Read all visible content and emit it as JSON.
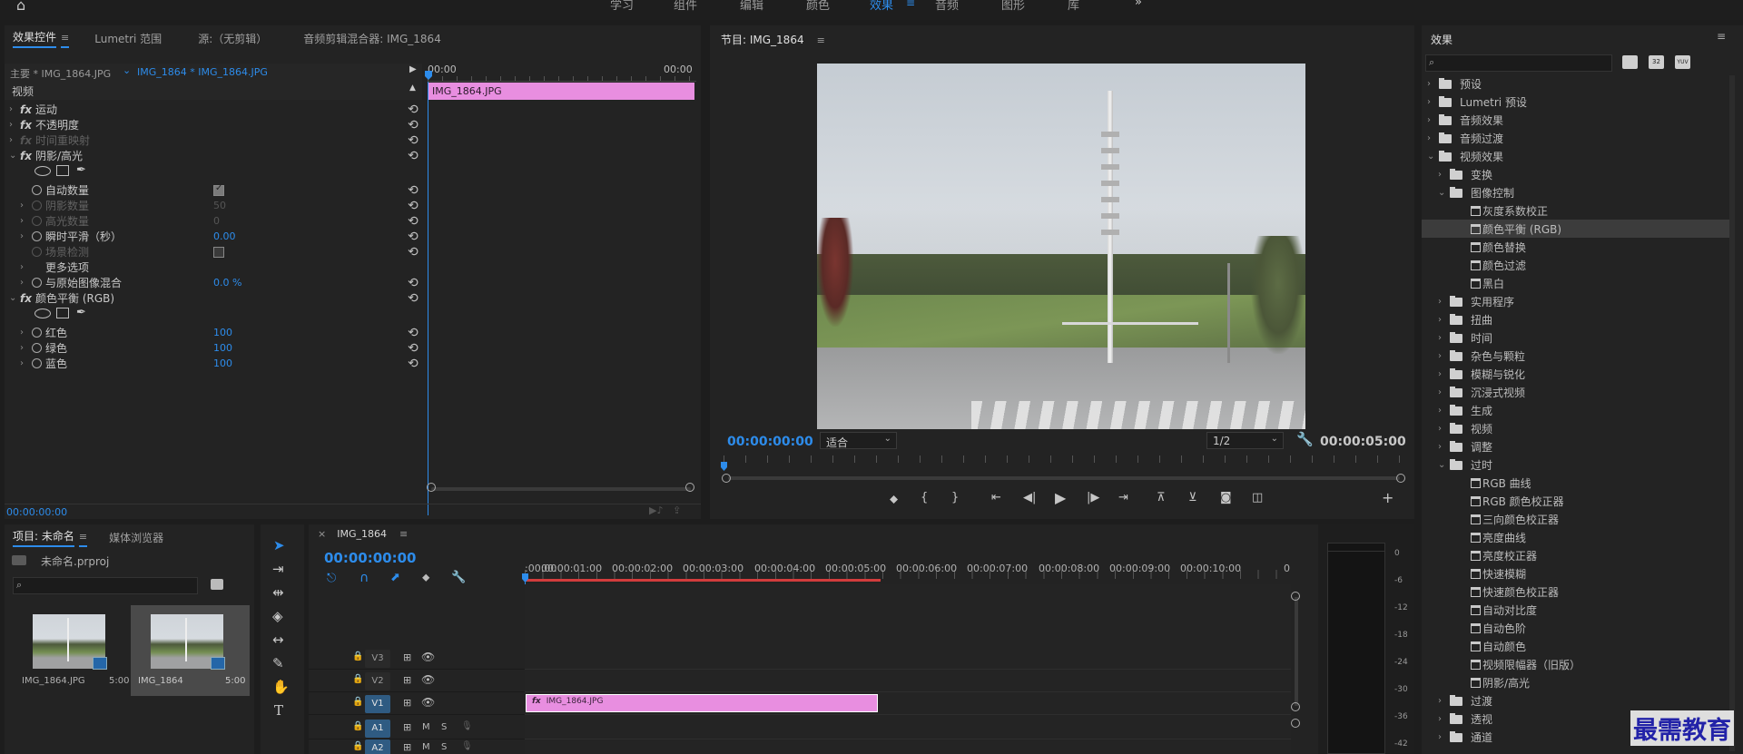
{
  "workspaces": {
    "items": [
      "学习",
      "组件",
      "编辑",
      "颜色",
      "效果",
      "音频",
      "图形",
      "库"
    ],
    "active_index": 4,
    "more": "»"
  },
  "effect_controls": {
    "tabs": [
      "效果控件",
      "Lumetri 范围",
      "源:（无剪辑）",
      "音频剪辑混合器: IMG_1864"
    ],
    "master_label": "主要 * IMG_1864.JPG",
    "clip_label": "IMG_1864 * IMG_1864.JPG",
    "time_start": "00:00",
    "time_end": "00:00",
    "clip_bar_label": "IMG_1864.JPG",
    "section_video": "视频",
    "rows": [
      {
        "label": "运动",
        "fx": true
      },
      {
        "label": "不透明度",
        "fx": true
      },
      {
        "label": "时间重映射",
        "fx": true,
        "dim": true
      },
      {
        "label": "阴影/高光",
        "fx": true,
        "open": true
      },
      {
        "label": "自动数量",
        "check": true,
        "checked": true
      },
      {
        "label": "阴影数量",
        "value": "50",
        "dim": true,
        "chev": true
      },
      {
        "label": "高光数量",
        "value": "0",
        "dim": true,
        "chev": true
      },
      {
        "label": "瞬时平滑（秒）",
        "value": "0.00",
        "chev": true
      },
      {
        "label": "场景检测",
        "check": true,
        "checked": false,
        "dim": true
      },
      {
        "label": "更多选项",
        "chev": true,
        "nostop": true
      },
      {
        "label": "与原始图像混合",
        "value": "0.0 %",
        "chev": true
      },
      {
        "label": "颜色平衡 (RGB)",
        "fx": true,
        "open": true
      },
      {
        "label": "红色",
        "value": "100",
        "chev": true
      },
      {
        "label": "绿色",
        "value": "100",
        "chev": true
      },
      {
        "label": "蓝色",
        "value": "100",
        "chev": true
      }
    ],
    "timecode": "00:00:00:00"
  },
  "program_monitor": {
    "title": "节目: IMG_1864",
    "timecode": "00:00:00:00",
    "fit": "适合",
    "resolution": "1/2",
    "duration": "00:00:05:00"
  },
  "effects_panel": {
    "title": "效果",
    "search_placeholder": "",
    "filter_badges": [
      "32",
      "YUV"
    ],
    "items": [
      {
        "label": "预设",
        "level": 0,
        "type": "folder",
        "chev": "›"
      },
      {
        "label": "Lumetri 预设",
        "level": 0,
        "type": "folder",
        "chev": "›"
      },
      {
        "label": "音频效果",
        "level": 0,
        "type": "folder",
        "chev": "›"
      },
      {
        "label": "音频过渡",
        "level": 0,
        "type": "folder",
        "chev": "›"
      },
      {
        "label": "视频效果",
        "level": 0,
        "type": "folder",
        "chev": "⌄"
      },
      {
        "label": "变换",
        "level": 1,
        "type": "folder",
        "chev": "›"
      },
      {
        "label": "图像控制",
        "level": 1,
        "type": "folder",
        "chev": "⌄"
      },
      {
        "label": "灰度系数校正",
        "level": 2,
        "type": "fx"
      },
      {
        "label": "颜色平衡 (RGB)",
        "level": 2,
        "type": "fx",
        "selected": true
      },
      {
        "label": "颜色替换",
        "level": 2,
        "type": "fx"
      },
      {
        "label": "颜色过滤",
        "level": 2,
        "type": "fx"
      },
      {
        "label": "黑白",
        "level": 2,
        "type": "fx"
      },
      {
        "label": "实用程序",
        "level": 1,
        "type": "folder",
        "chev": "›"
      },
      {
        "label": "扭曲",
        "level": 1,
        "type": "folder",
        "chev": "›"
      },
      {
        "label": "时间",
        "level": 1,
        "type": "folder",
        "chev": "›"
      },
      {
        "label": "杂色与颗粒",
        "level": 1,
        "type": "folder",
        "chev": "›"
      },
      {
        "label": "模糊与锐化",
        "level": 1,
        "type": "folder",
        "chev": "›"
      },
      {
        "label": "沉浸式视频",
        "level": 1,
        "type": "folder",
        "chev": "›"
      },
      {
        "label": "生成",
        "level": 1,
        "type": "folder",
        "chev": "›"
      },
      {
        "label": "视频",
        "level": 1,
        "type": "folder",
        "chev": "›"
      },
      {
        "label": "调整",
        "level": 1,
        "type": "folder",
        "chev": "›"
      },
      {
        "label": "过时",
        "level": 1,
        "type": "folder",
        "chev": "⌄"
      },
      {
        "label": "RGB 曲线",
        "level": 2,
        "type": "fx"
      },
      {
        "label": "RGB 颜色校正器",
        "level": 2,
        "type": "fx"
      },
      {
        "label": "三向颜色校正器",
        "level": 2,
        "type": "fx"
      },
      {
        "label": "亮度曲线",
        "level": 2,
        "type": "fx"
      },
      {
        "label": "亮度校正器",
        "level": 2,
        "type": "fx"
      },
      {
        "label": "快速模糊",
        "level": 2,
        "type": "fx"
      },
      {
        "label": "快速颜色校正器",
        "level": 2,
        "type": "fx"
      },
      {
        "label": "自动对比度",
        "level": 2,
        "type": "fx"
      },
      {
        "label": "自动色阶",
        "level": 2,
        "type": "fx"
      },
      {
        "label": "自动颜色",
        "level": 2,
        "type": "fx"
      },
      {
        "label": "视频限幅器（旧版）",
        "level": 2,
        "type": "fx"
      },
      {
        "label": "阴影/高光",
        "level": 2,
        "type": "fx"
      },
      {
        "label": "过渡",
        "level": 1,
        "type": "folder",
        "chev": "›"
      },
      {
        "label": "透视",
        "level": 1,
        "type": "folder",
        "chev": "›"
      },
      {
        "label": "通道",
        "level": 1,
        "type": "folder",
        "chev": "›"
      }
    ]
  },
  "project": {
    "tabs": [
      "项目: 未命名",
      "媒体浏览器"
    ],
    "file": "未命名.prproj",
    "items": [
      {
        "name": "IMG_1864.JPG",
        "duration": "5:00"
      },
      {
        "name": "IMG_1864",
        "duration": "5:00"
      }
    ]
  },
  "timeline": {
    "tab": "IMG_1864",
    "timecode": "00:00:00:00",
    "ruler": [
      ":00:00",
      "00:00:01:00",
      "00:00:02:00",
      "00:00:03:00",
      "00:00:04:00",
      "00:00:05:00",
      "00:00:06:00",
      "00:00:07:00",
      "00:00:08:00",
      "00:00:09:00",
      "00:00:10:00",
      "0"
    ],
    "tracks": [
      {
        "name": "V3",
        "type": "video",
        "targeted": false
      },
      {
        "name": "V2",
        "type": "video",
        "targeted": false
      },
      {
        "name": "V1",
        "type": "video",
        "targeted": true
      },
      {
        "name": "A1",
        "type": "audio",
        "targeted": true
      },
      {
        "name": "A2",
        "type": "audio",
        "targeted": true
      }
    ],
    "audio_m": "M",
    "audio_s": "S",
    "clip_label": "IMG_1864.JPG",
    "clip_fx": "fx"
  },
  "meter": {
    "labels": [
      "0",
      "-6",
      "-12",
      "-18",
      "-24",
      "-30",
      "-36",
      "-42"
    ]
  },
  "watermark": "最需教育",
  "colors": {
    "accent": "#2d8ceb",
    "clip": "#e88ee0",
    "bg": "#232323"
  }
}
